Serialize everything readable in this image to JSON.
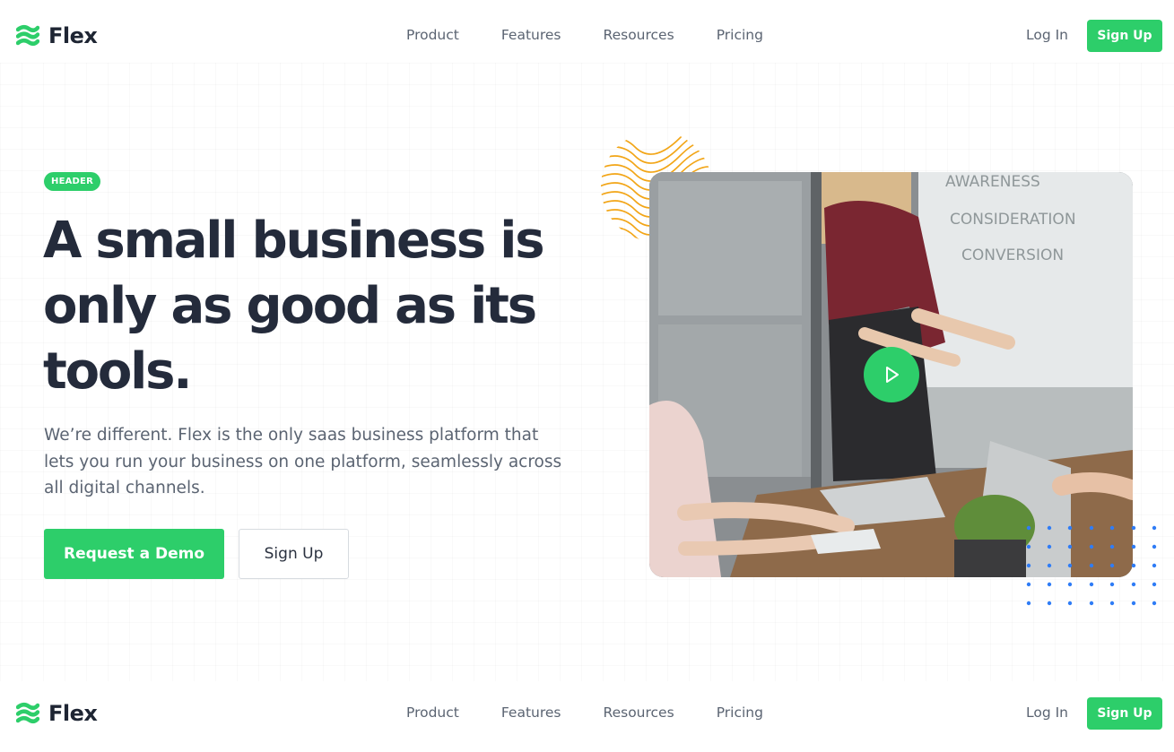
{
  "brand": {
    "name": "Flex",
    "accent": "#2dce6a",
    "logo_icon": "flex-wave-logo-icon"
  },
  "nav": {
    "links": [
      "Product",
      "Features",
      "Resources",
      "Pricing"
    ],
    "login_label": "Log In",
    "signup_label": "Sign Up"
  },
  "hero": {
    "badge": "HEADER",
    "headline": "A small business is only as good as its tools.",
    "subtext": "We’re different. Flex is the only saas business platform that lets you run your business on one platform, seamlessly across all digital channels.",
    "primary_cta": "Request a Demo",
    "secondary_cta": "Sign Up"
  },
  "video": {
    "whiteboard_lines": [
      "AWARENESS",
      "CONSIDERATION",
      "CONVERSION"
    ],
    "play_icon": "play-icon"
  },
  "colors": {
    "heading": "#242b3b",
    "body_text": "#5b6472",
    "accent": "#2dce6a",
    "ring_accent": "#f2a516",
    "dot_accent": "#2f7cf6"
  }
}
